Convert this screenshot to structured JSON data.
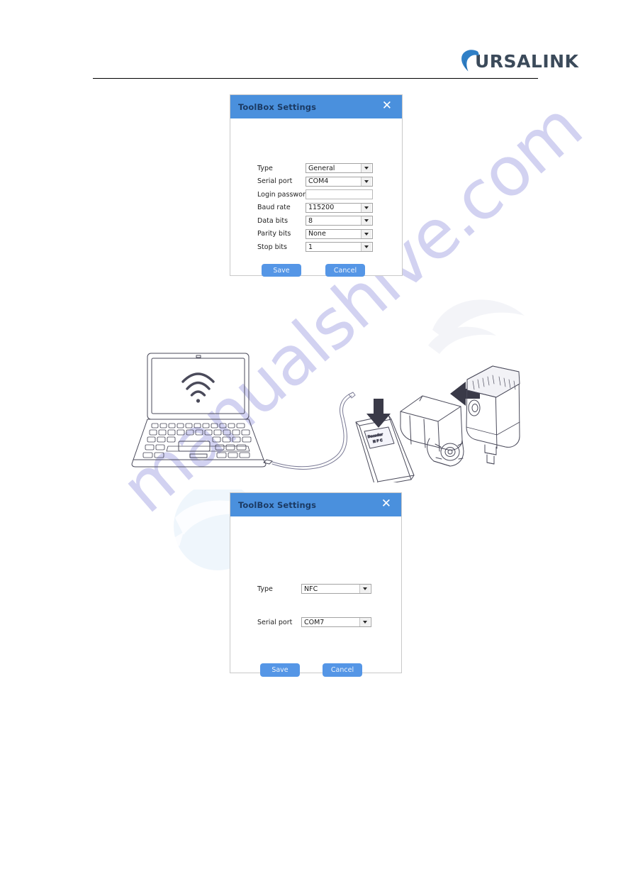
{
  "header": {
    "brand_name": "URSALINK",
    "brand_mark_icon": "ursalink-swoosh-icon"
  },
  "watermark": {
    "text": "manualshive.com",
    "color": "#cfcff0"
  },
  "dialog_general": {
    "title": "ToolBox Settings",
    "close_label": "✕",
    "fields": [
      {
        "label": "Type",
        "value": "General",
        "control": "dropdown"
      },
      {
        "label": "Serial port",
        "value": "COM4",
        "control": "dropdown"
      },
      {
        "label": "Login password",
        "value": "",
        "control": "text"
      },
      {
        "label": "Baud rate",
        "value": "115200",
        "control": "dropdown"
      },
      {
        "label": "Data bits",
        "value": "8",
        "control": "dropdown"
      },
      {
        "label": "Parity bits",
        "value": "None",
        "control": "dropdown"
      },
      {
        "label": "Stop bits",
        "value": "1",
        "control": "dropdown"
      }
    ],
    "save_label": "Save",
    "cancel_label": "Cancel",
    "titlebar_color": "#4a90dd",
    "button_color": "#5596e6"
  },
  "dialog_nfc": {
    "title": "ToolBox Settings",
    "close_label": "✕",
    "fields": [
      {
        "label": "Type",
        "value": "NFC",
        "control": "dropdown"
      },
      {
        "label": "Serial port",
        "value": "COM7",
        "control": "dropdown"
      }
    ],
    "save_label": "Save",
    "cancel_label": "Cancel",
    "titlebar_color": "#4a90dd",
    "button_color": "#5596e6"
  },
  "illustration": {
    "laptop_icon": "laptop-line-drawing",
    "wifi_icon": "wifi-icon",
    "cable_icon": "usb-cable-icon",
    "nfc_reader_icon": "nfc-reader-pad-icon",
    "nfc_tag_label_line1": "Decoder",
    "nfc_tag_label_line2": "N F C",
    "down_arrow_icon": "arrow-down-icon",
    "valve_icon": "valve-actuator-icon",
    "left_arrow_icon": "arrow-left-icon",
    "sensor_icon": "sensor-module-icon"
  }
}
